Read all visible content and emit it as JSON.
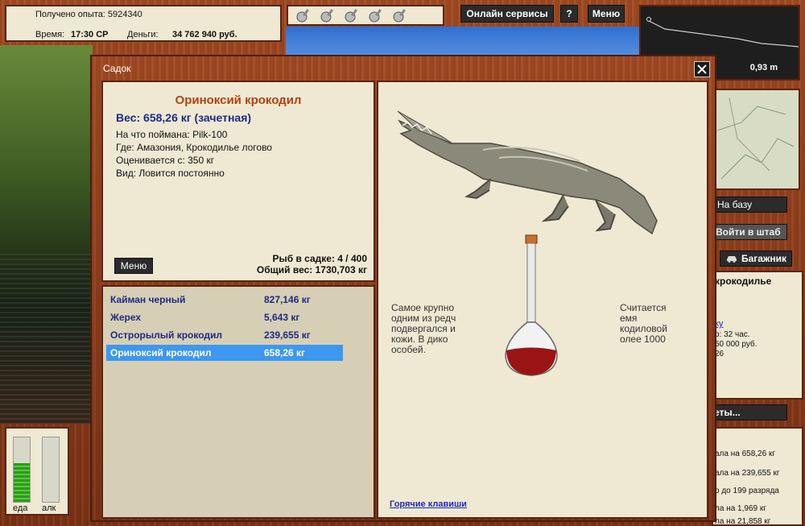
{
  "top_stats": {
    "exp_label": "Получено опыта: 5924340",
    "time_label": "Время:",
    "time_value": "17:30 СР",
    "money_label": "Деньги:",
    "money_value": "34 762 940 руб."
  },
  "top_buttons": {
    "online": "Онлайн сервисы",
    "help": "?",
    "menu": "Меню"
  },
  "depth_map": {
    "distance": "0,93 m"
  },
  "right_panel": {
    "to_base": "На базу",
    "to_hq": "Войти в штаб",
    "trunk": "Багажник",
    "location_title": "крокодилье",
    "link": "ку",
    "line1": "о: 32 час.",
    "line2": "50 000 руб.",
    "line3": "26",
    "cut_button": "еты...",
    "log": [
      "ала на 658,26 кг",
      "ала на 239,655 кг",
      "о до 199  разряда",
      "ла на 1,969 кг",
      "ла на 21,858 кг"
    ]
  },
  "meters": {
    "food": "еда",
    "alc": "алк",
    "food_level": 0.6,
    "alc_level": 0.0
  },
  "dialog": {
    "title": "Садок",
    "fish_name": "Ориноксий крокодил",
    "weight": "Вес: 658,26 кг (зачетная)",
    "caught_on": "На что поймана: Pilk-100",
    "where": "Где: Амазония, Крокодилье логово",
    "rated_from": "Оценивается с: 350 кг",
    "kind": "Вид: Ловится постоянно",
    "menu_button": "Меню",
    "fish_count": "Рыб в садке: 4 / 400",
    "total_weight": "Общий вес: 1730,703 кг",
    "fish_list": [
      {
        "name": "Кайман черный",
        "weight": "827,146 кг"
      },
      {
        "name": "Жерех",
        "weight": "5,643 кг"
      },
      {
        "name": "Острорылый крокодил",
        "weight": "239,655 кг"
      },
      {
        "name": "Ориноксий крокодил",
        "weight": "658,26 кг"
      }
    ],
    "desc_left": [
      "Самое крупно",
      "одним из редч",
      "подвергался и",
      "кожи.  В дико",
      "особей."
    ],
    "desc_right": [
      "Считается",
      "емя",
      "кодиловой",
      "олее 1000"
    ],
    "hotkeys": "Горячие клавиши"
  },
  "colors": {
    "accent": "#b5400e",
    "list_text": "#1f2a86",
    "selection": "#3c98f0"
  }
}
